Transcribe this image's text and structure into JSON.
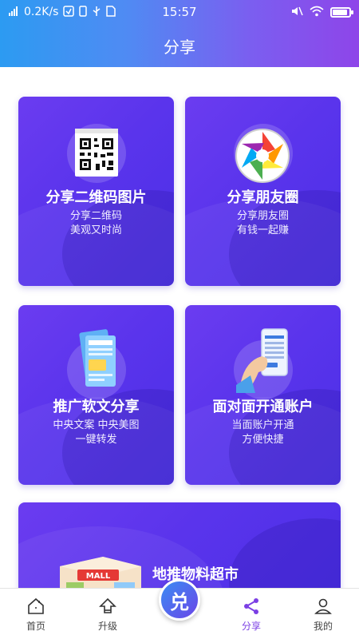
{
  "status_bar": {
    "signal_icon": "signal-icon",
    "speed": "0.2K/s",
    "time": "15:57",
    "battery_level": 0.9
  },
  "header": {
    "title": "分享"
  },
  "cards": [
    {
      "title": "分享二维码图片",
      "sub1": "分享二维码",
      "sub2": "美观又时尚",
      "icon": "qrcode-icon"
    },
    {
      "title": "分享朋友圈",
      "sub1": "分享朋友圈",
      "sub2": "有钱一起赚",
      "icon": "aperture-icon"
    },
    {
      "title": "推广软文分享",
      "sub1": "中央文案  中央美图",
      "sub2": "一键转发",
      "icon": "document-icon"
    },
    {
      "title": "面对面开通账户",
      "sub1": "当面账户开通",
      "sub2": "方便快捷",
      "icon": "phone-hand-icon"
    },
    {
      "title": "地推物料超市",
      "sub1": "",
      "sub2": "",
      "icon": "mall-icon"
    }
  ],
  "nav": {
    "items": [
      {
        "label": "首页",
        "icon": "home-icon"
      },
      {
        "label": "升级",
        "icon": "upgrade-icon"
      },
      {
        "label": "",
        "center_char": "兑",
        "icon": "exchange-icon"
      },
      {
        "label": "分享",
        "icon": "share-icon"
      },
      {
        "label": "我的",
        "icon": "user-icon"
      }
    ],
    "active_index": 3
  },
  "colors": {
    "accent": "#7b3fe4",
    "card_start": "#6b3cf0",
    "card_end": "#4a2fe6"
  }
}
